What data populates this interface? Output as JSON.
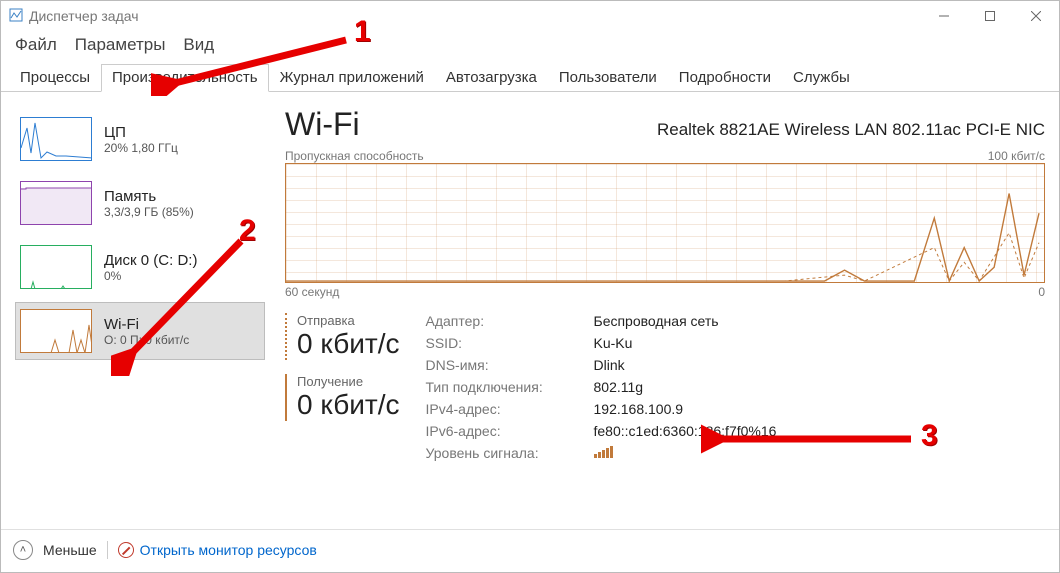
{
  "window": {
    "title": "Диспетчер задач"
  },
  "menu": {
    "file": "Файл",
    "options": "Параметры",
    "view": "Вид"
  },
  "tabs": {
    "processes": "Процессы",
    "performance": "Производительность",
    "app_history": "Журнал приложений",
    "startup": "Автозагрузка",
    "users": "Пользователи",
    "details": "Подробности",
    "services": "Службы"
  },
  "sidebar": {
    "cpu": {
      "title": "ЦП",
      "sub": "20%  1,80 ГГц"
    },
    "memory": {
      "title": "Память",
      "sub": "3,3/3,9 ГБ (85%)"
    },
    "disk": {
      "title": "Диск 0 (C: D:)",
      "sub": "0%"
    },
    "wifi": {
      "title": "Wi-Fi",
      "sub": "О: 0  П: 0 кбит/с"
    }
  },
  "main": {
    "title": "Wi-Fi",
    "adapter_name": "Realtek 8821AE Wireless LAN 802.11ac PCI-E NIC",
    "chart_label": "Пропускная способность",
    "chart_max": "100 кбит/c",
    "chart_left": "60 секунд",
    "chart_right": "0",
    "send_label": "Отправка",
    "send_value": "0 кбит/c",
    "recv_label": "Получение",
    "recv_value": "0 кбит/c",
    "props": {
      "adapter_k": "Адаптер:",
      "adapter_v": "Беспроводная сеть",
      "ssid_k": "SSID:",
      "ssid_v": "Ku-Ku",
      "dns_k": "DNS-имя:",
      "dns_v": "Dlink",
      "type_k": "Тип подключения:",
      "type_v": "802.11g",
      "ipv4_k": "IPv4-адрес:",
      "ipv4_v": "192.168.100.9",
      "ipv6_k": "IPv6-адрес:",
      "ipv6_v": "fe80::c1ed:6360:186:f7f0%16",
      "signal_k": "Уровень сигнала:"
    }
  },
  "bottom": {
    "less": "Меньше",
    "resmon": "Открыть монитор ресурсов"
  },
  "annotations": {
    "n1": "1",
    "n2": "2",
    "n3": "3"
  },
  "chart_data": {
    "type": "line",
    "title": "Пропускная способность",
    "xlabel": "секунд",
    "ylabel": "кбит/c",
    "xlim": [
      60,
      0
    ],
    "ylim": [
      0,
      100
    ],
    "series": [
      {
        "name": "Отправка",
        "x": [
          60,
          50,
          40,
          30,
          20,
          16,
          14,
          12,
          10,
          8,
          6,
          5,
          4,
          3,
          2,
          1,
          0
        ],
        "values": [
          0,
          0,
          0,
          0,
          0,
          0,
          10,
          0,
          0,
          55,
          0,
          30,
          0,
          12,
          75,
          5,
          60
        ]
      },
      {
        "name": "Получение",
        "x": [
          60,
          50,
          40,
          30,
          20,
          16,
          14,
          12,
          10,
          8,
          6,
          5,
          4,
          3,
          2,
          1,
          0
        ],
        "values": [
          0,
          0,
          0,
          0,
          0,
          0,
          5,
          0,
          0,
          30,
          0,
          15,
          0,
          6,
          40,
          3,
          35
        ]
      }
    ]
  }
}
